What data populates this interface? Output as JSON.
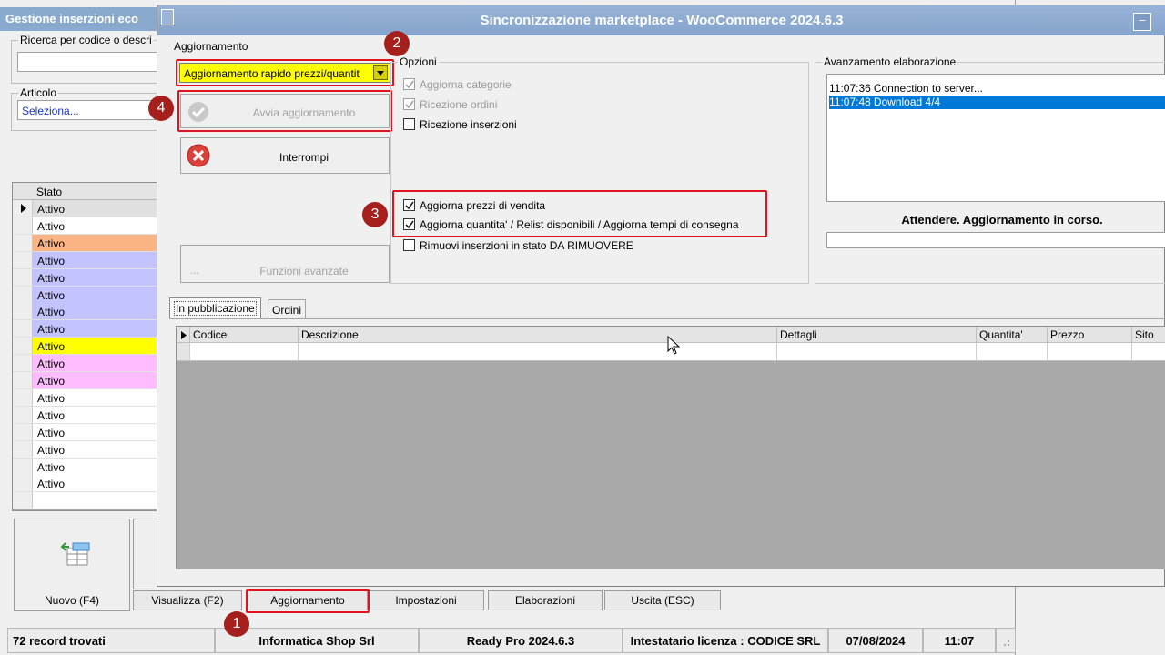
{
  "background": {
    "window_title": "Gestione inserzioni eco",
    "search_label": "Ricerca per codice o descri",
    "search_value": "",
    "articolo_label": "Articolo",
    "articolo_value": "Seleziona...",
    "table_header": "Stato",
    "rows": [
      {
        "text": "Attivo",
        "color": "#e0e0e0",
        "current": true
      },
      {
        "text": "Attivo",
        "color": "#ffffff"
      },
      {
        "text": "Attivo",
        "color": "#fbb585"
      },
      {
        "text": "Attivo",
        "color": "#c3c3ff"
      },
      {
        "text": "Attivo",
        "color": "#c3c3ff"
      },
      {
        "text": "Attivo",
        "color": "#c3c3ff"
      },
      {
        "text": "Attivo",
        "color": "#c3c3ff"
      },
      {
        "text": "Attivo",
        "color": "#c3c3ff"
      },
      {
        "text": "Attivo",
        "color": "#ffff00"
      },
      {
        "text": "Attivo",
        "color": "#ffbcff"
      },
      {
        "text": "Attivo",
        "color": "#ffbcff"
      },
      {
        "text": "Attivo",
        "color": "#ffffff"
      },
      {
        "text": "Attivo",
        "color": "#ffffff"
      },
      {
        "text": "Attivo",
        "color": "#ffffff"
      },
      {
        "text": "Attivo",
        "color": "#ffffff"
      },
      {
        "text": "Attivo",
        "color": "#ffffff"
      },
      {
        "text": "Attivo",
        "color": "#ffffff"
      },
      {
        "text": "",
        "color": "#ffffff"
      }
    ],
    "bottom_buttons": {
      "nuovo": "Nuovo (F4)",
      "visualizza": "Visualizza (F2)",
      "aggiornamento": "Aggiornamento",
      "impostazioni": "Impostazioni",
      "elaborazioni": "Elaborazioni",
      "uscita": "Uscita (ESC)"
    },
    "status": {
      "records": "72 record trovati",
      "company": "Informatica Shop Srl",
      "version": "Ready Pro 2024.6.3",
      "license": "Intestatario licenza : CODICE SRL",
      "date": "07/08/2024",
      "time": "11:07"
    }
  },
  "dialog": {
    "title": "Sincronizzazione marketplace - WooCommerce 2024.6.3",
    "minimize": "–",
    "aggiornamento_group": "Aggiornamento",
    "mode_selected": "Aggiornamento rapido prezzi/quantit",
    "avvia_label": "Avvia aggiornamento",
    "interrompi_label": "Interrompi",
    "funzioni_label": "Funzioni avanzate",
    "funzioni_prefix": "...",
    "opzioni_group": "Opzioni",
    "options": [
      {
        "label": "Aggiorna categorie",
        "checked": true,
        "disabled": true
      },
      {
        "label": "Ricezione ordini",
        "checked": true,
        "disabled": true
      },
      {
        "label": "Ricezione inserzioni",
        "checked": false,
        "disabled": false
      },
      {
        "label": "Aggiorna prezzi di vendita",
        "checked": true,
        "disabled": false
      },
      {
        "label": "Aggiorna quantita' / Relist disponibili / Aggiorna tempi di consegna",
        "checked": true,
        "disabled": false
      },
      {
        "label": "Rimuovi inserzioni in stato DA RIMUOVERE",
        "checked": false,
        "disabled": false
      }
    ],
    "avanzamento_group": "Avanzamento elaborazione",
    "log": [
      {
        "time": "11:07:36",
        "text": "Connection to server..."
      },
      {
        "time": "11:07:48",
        "text": "Download 4/4"
      }
    ],
    "wait_text": "Attendere. Aggiornamento in corso.",
    "tabs": [
      "In pubblicazione",
      "Ordini"
    ],
    "columns": [
      "Codice",
      "Descrizione",
      "Dettagli",
      "Quantita'",
      "Prezzo",
      "Sito"
    ]
  },
  "markers": [
    "1",
    "2",
    "3",
    "4"
  ],
  "colors": {
    "highlight": "#e0141e",
    "marker": "#a5201c",
    "selected_log": "#0078d7",
    "combo_yellow": "#ffff00"
  }
}
